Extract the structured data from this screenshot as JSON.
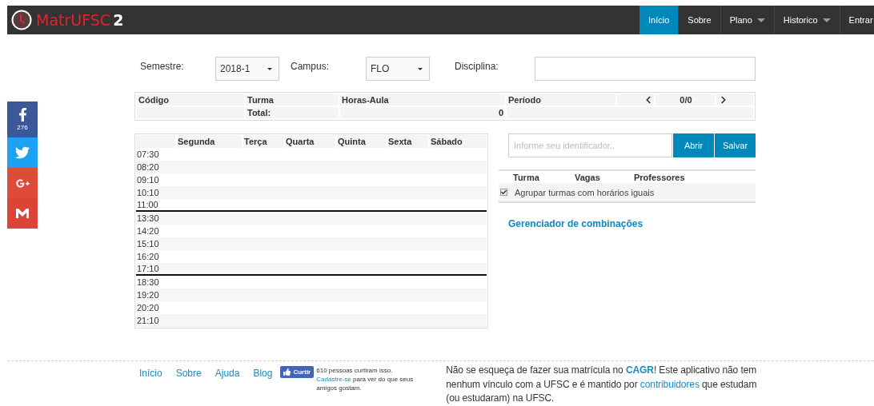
{
  "navbar": {
    "brand": {
      "name": "MatrUFSC",
      "version": "2"
    },
    "items": [
      {
        "label": "Início",
        "selected": true,
        "dropdown": false
      },
      {
        "label": "Sobre",
        "selected": false,
        "dropdown": false
      },
      {
        "label": "Plano",
        "selected": false,
        "dropdown": true
      },
      {
        "label": "Historico",
        "selected": false,
        "dropdown": true
      },
      {
        "label": "Entrar",
        "selected": false
      }
    ]
  },
  "share": {
    "count": "276",
    "buttons": [
      {
        "kind": "facebook"
      },
      {
        "kind": "twitter"
      },
      {
        "kind": "googleplus"
      },
      {
        "kind": "gmail"
      }
    ]
  },
  "filters": {
    "semestre": {
      "label": "Semestre:",
      "value": "2018-1"
    },
    "campus": {
      "label": "Campus:",
      "value": "FLO"
    },
    "disciplina": {
      "label": "Disciplina:"
    }
  },
  "summary": {
    "columns": [
      "Código",
      "Turma",
      "Horas-Aula",
      "Período"
    ],
    "pager": "0/0",
    "total_label": "Total:",
    "total_value": "0"
  },
  "schedule": {
    "days": [
      "Segunda",
      "Terça",
      "Quarta",
      "Quinta",
      "Sexta",
      "Sábado"
    ],
    "periods": [
      {
        "times": [
          "07:30",
          "08:20",
          "09:10",
          "10:10",
          "11:00"
        ]
      },
      {
        "times": [
          "13:30",
          "14:20",
          "15:10",
          "16:20",
          "17:10"
        ]
      },
      {
        "times": [
          "18:30",
          "19:20",
          "20:20",
          "21:10"
        ]
      }
    ]
  },
  "identifier": {
    "placeholder": "Informe seu identificador..",
    "buttons": [
      "Abrir",
      "Salvar"
    ]
  },
  "turmas": {
    "columns": [
      "Turma",
      "Vagas",
      "Professores"
    ],
    "group_option": {
      "label": "Agrupar turmas com horários iguais",
      "checked": true
    }
  },
  "combinations_link": "Gerenciador de combinações",
  "footer": {
    "links": [
      "Início",
      "Sobre",
      "Ajuda",
      "Blog"
    ],
    "like": {
      "button": "Curtir",
      "parts": [
        {
          "kind": "text",
          "text": "610 pessoas curtiram isso. "
        },
        {
          "kind": "link",
          "text": "Cadastre-se"
        },
        {
          "kind": "text",
          "text": " para ver do que seus amigos gostam."
        }
      ]
    },
    "notice": [
      {
        "kind": "text",
        "text": "Não se esqueça de fazer sua matrícula no "
      },
      {
        "kind": "strong_link",
        "text": "CAGR"
      },
      {
        "kind": "text",
        "text": "! Este aplicativo não tem nenhum vínculo com a UFSC e é mantido por "
      },
      {
        "kind": "link",
        "text": "contribuidores"
      },
      {
        "kind": "text",
        "text": " que estudam (ou estudaram) na UFSC."
      }
    ]
  }
}
